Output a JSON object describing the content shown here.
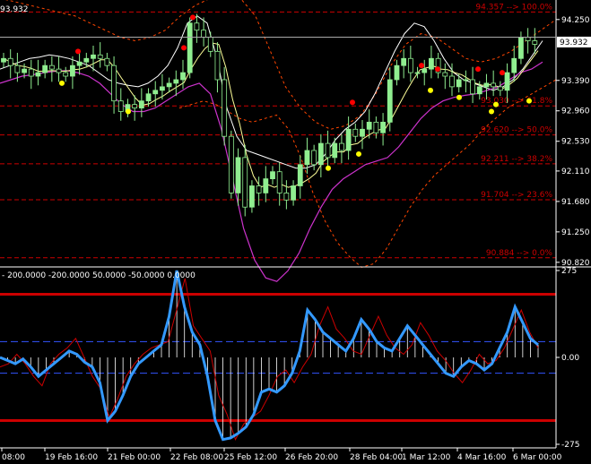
{
  "chart_data": [
    {
      "type": "candlestick",
      "y_axis_ticks": [
        "94.250",
        "93.390",
        "92.960",
        "92.530",
        "92.110",
        "91.680",
        "91.250",
        "90.820"
      ],
      "y_tick_values": [
        94.25,
        93.39,
        92.96,
        92.53,
        92.11,
        91.68,
        91.25,
        90.82
      ],
      "ylim": [
        90.82,
        94.25
      ],
      "current_price": "93.932",
      "current_price_value": 93.932,
      "top_left_label": "93.932",
      "top_price_line_value": 94.0,
      "fibonacci_levels": [
        {
          "label": "94.357 --> 100.0%",
          "value": 94.357
        },
        {
          "label": "93.030 --> 61.8%",
          "value": 93.03
        },
        {
          "label": "92.620 --> 50.0%",
          "value": 92.62
        },
        {
          "label": "92.211 --> 38.2%",
          "value": 92.211
        },
        {
          "label": "91.704 --> 23.6%",
          "value": 91.704
        },
        {
          "label": "90.884 --> 0.0%",
          "value": 90.884
        }
      ],
      "series": [
        {
          "close": [
            93.7,
            93.6,
            93.5,
            93.55,
            93.45,
            93.5,
            93.6,
            93.55,
            93.5,
            93.45,
            93.6,
            93.65,
            93.7,
            93.75,
            93.7,
            93.6,
            93.1,
            92.95,
            93.05,
            93.0,
            93.1,
            93.2,
            93.25,
            93.3,
            93.35,
            93.4,
            93.5,
            94.2,
            94.1,
            94.0,
            93.8,
            93.4,
            92.6,
            91.8,
            92.3,
            91.6,
            91.9,
            91.8,
            92.0,
            92.1,
            91.8,
            91.7,
            91.9,
            92.2,
            92.4,
            92.2,
            92.5,
            92.3,
            92.5,
            92.4,
            92.7,
            92.6,
            92.7,
            92.8,
            92.65,
            92.8,
            93.4,
            93.6,
            93.7,
            93.5,
            93.5,
            93.55,
            93.7,
            93.5,
            93.45,
            93.3,
            93.4,
            93.4,
            93.2,
            93.3,
            93.35,
            93.3,
            93.25,
            93.5,
            93.7,
            94.0,
            93.95,
            93.9
          ]
        },
        {
          "name": "moving_average_white",
          "values": [
            93.55,
            93.6,
            93.65,
            93.7,
            93.72,
            93.75,
            93.73,
            93.7,
            93.65,
            93.6,
            93.5,
            93.4,
            93.35,
            93.32,
            93.3,
            93.35,
            93.45,
            93.6,
            93.85,
            94.2,
            94.3,
            94.2,
            93.7,
            93.0,
            92.6,
            92.4,
            92.35,
            92.3,
            92.25,
            92.2,
            92.15,
            92.15,
            92.2,
            92.35,
            92.55,
            92.7,
            92.8,
            92.95,
            93.2,
            93.5,
            93.8,
            94.05,
            94.2,
            94.15,
            93.95,
            93.7,
            93.5,
            93.4,
            93.35,
            93.3,
            93.25,
            93.3,
            93.4,
            93.55,
            93.75,
            93.95
          ]
        },
        {
          "name": "moving_average_magenta",
          "values": [
            93.35,
            93.4,
            93.45,
            93.47,
            93.5,
            93.52,
            93.53,
            93.5,
            93.45,
            93.35,
            93.2,
            93.05,
            92.95,
            92.95,
            93.0,
            93.1,
            93.2,
            93.3,
            93.35,
            93.2,
            92.7,
            92.0,
            91.3,
            90.85,
            90.6,
            90.55,
            90.7,
            90.95,
            91.3,
            91.6,
            91.85,
            92.0,
            92.1,
            92.2,
            92.25,
            92.3,
            92.45,
            92.65,
            92.85,
            93.0,
            93.1,
            93.15,
            93.18,
            93.2,
            93.25,
            93.3,
            93.4,
            93.5,
            93.55,
            93.65
          ]
        },
        {
          "name": "envelope_upper",
          "values": [
            94.55,
            94.5,
            94.45,
            94.4,
            94.35,
            94.3,
            94.2,
            94.1,
            94.0,
            93.95,
            94.0,
            94.1,
            94.3,
            94.45,
            94.55,
            94.6,
            94.55,
            94.3,
            93.8,
            93.3,
            93.0,
            92.8,
            92.7,
            92.75,
            92.9,
            93.2,
            93.6,
            93.9,
            94.05,
            94.0,
            93.85,
            93.7,
            93.65,
            93.7,
            93.8,
            93.95,
            94.1,
            94.25
          ]
        },
        {
          "name": "envelope_lower",
          "values": [
            93.0,
            93.05,
            93.1,
            93.05,
            92.95,
            92.85,
            92.8,
            92.85,
            92.9,
            92.7,
            92.3,
            91.8,
            91.4,
            91.1,
            90.9,
            90.75,
            90.8,
            91.0,
            91.3,
            91.6,
            91.85,
            92.05,
            92.2,
            92.35,
            92.5,
            92.7,
            92.85,
            93.0,
            93.1,
            93.2,
            93.3,
            93.4
          ]
        },
        {
          "name": "swing_high_markers",
          "values": [
            93.8,
            93.85,
            94.28,
            93.08,
            93.6,
            93.55,
            93.55,
            93.5
          ]
        },
        {
          "name": "swing_low_markers",
          "values": [
            93.35,
            92.95,
            92.15,
            92.35,
            93.25,
            93.15,
            92.95,
            93.05,
            93.1
          ]
        }
      ]
    },
    {
      "type": "line",
      "header_label": "- 200.0000 -200.0000 50.0000 -50.0000 0.0000",
      "y_axis_ticks": [
        "275",
        "0.00",
        "-275"
      ],
      "y_tick_values": [
        275,
        0,
        -275
      ],
      "ylim": [
        -275,
        275
      ],
      "levels": [
        200,
        50,
        -50,
        -200
      ],
      "series": [
        {
          "name": "cci_main",
          "values": [
            0,
            -10,
            -20,
            -5,
            -30,
            -60,
            -40,
            -20,
            0,
            20,
            10,
            -15,
            -30,
            -80,
            -200,
            -170,
            -120,
            -60,
            -20,
            0,
            20,
            40,
            130,
            275,
            160,
            80,
            40,
            -60,
            -200,
            -260,
            -255,
            -240,
            -220,
            -180,
            -110,
            -100,
            -110,
            -90,
            -50,
            20,
            150,
            120,
            80,
            60,
            40,
            20,
            60,
            120,
            90,
            50,
            30,
            20,
            60,
            100,
            70,
            40,
            10,
            -20,
            -50,
            -60,
            -30,
            -10,
            -20,
            -40,
            -20,
            30,
            80,
            160,
            110,
            60,
            40
          ]
        },
        {
          "name": "cci_signal",
          "values": [
            -30,
            -20,
            10,
            -20,
            -60,
            -90,
            -20,
            10,
            30,
            60,
            0,
            -60,
            -100,
            -190,
            -130,
            -60,
            -20,
            10,
            30,
            40,
            50,
            150,
            250,
            100,
            60,
            20,
            -120,
            -180,
            -260,
            -210,
            -190,
            -170,
            -120,
            -60,
            -40,
            -80,
            -30,
            10,
            100,
            160,
            90,
            60,
            20,
            10,
            70,
            130,
            70,
            30,
            10,
            40,
            110,
            70,
            20,
            -10,
            -50,
            -80,
            -40,
            10,
            -20,
            -10,
            30,
            90,
            150,
            80,
            30
          ]
        },
        {
          "name": "histogram",
          "values": [
            0,
            -10,
            -20,
            -5,
            -30,
            -60,
            -40,
            -20,
            0,
            20,
            10,
            -15,
            -30,
            -80,
            -200,
            -170,
            -120,
            -60,
            -20,
            0,
            20,
            40,
            130,
            275,
            160,
            80,
            40,
            -60,
            -200,
            -260,
            -255,
            -240,
            -220,
            -180,
            -110,
            -100,
            -110,
            -90,
            -50,
            20,
            150,
            120,
            80,
            60,
            40,
            20,
            60,
            120,
            90,
            50,
            30,
            20,
            60,
            100,
            70,
            40,
            10,
            -20,
            -50,
            -60,
            -30,
            -10,
            -20,
            -40,
            -20,
            30,
            80,
            160,
            110,
            60,
            40
          ]
        }
      ]
    }
  ],
  "x_axis_ticks": [
    "08:00",
    "19 Feb 16:00",
    "21 Feb 00:00",
    "22 Feb 08:00",
    "25 Feb 12:00",
    "26 Feb 20:00",
    "28 Feb 04:00",
    "1 Mar 12:00",
    "4 Mar 16:00",
    "6 Mar 00:00"
  ],
  "colors": {
    "background": "#000000",
    "grid": "#ffffff",
    "axis_text": "#ffffff",
    "bull_candle": "#90ee90",
    "bear_candle": "#000000",
    "wick": "#90ee90",
    "ma_white": "#ffffff",
    "ma_yellow": "#ffff99",
    "ma_magenta": "#cc33cc",
    "envelope": "#ff4500",
    "fibo_line": "#cc0000",
    "fibo_text": "#cc0000",
    "swing_high": "#ff0000",
    "swing_low": "#ffff00",
    "cci_main": "#3399ff",
    "cci_signal": "#cc0000",
    "histogram": "#ffffff",
    "level_outer": "#cc0000",
    "level_inner": "#3355ff",
    "current_box_bg": "#ffffff",
    "current_box_fg": "#000000"
  }
}
